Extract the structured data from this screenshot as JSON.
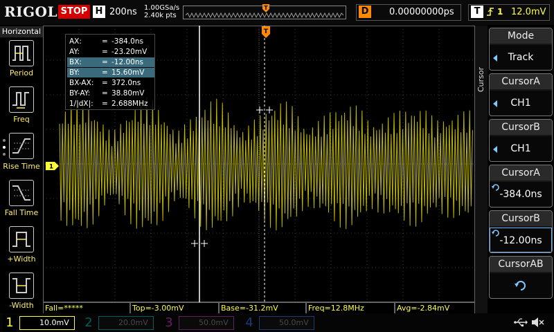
{
  "top_bar": {
    "logo": "RIGOL",
    "run_status": "STOP",
    "timebase_label": "H",
    "timebase": "200ns",
    "sample_rate": "1.00GSa/s",
    "memory_depth": "2.40k pts",
    "delay_label": "D",
    "delay": "0.00000000ps",
    "trigger_label": "T",
    "trigger_source": "1",
    "trigger_level": "12.0mV"
  },
  "left_menu": {
    "title": "Horizontal",
    "items": [
      {
        "label": "Period"
      },
      {
        "label": "Freq"
      },
      {
        "label": "Rise Time"
      },
      {
        "label": "Fall Time"
      },
      {
        "label": "+Width"
      },
      {
        "label": "-Width"
      }
    ]
  },
  "cursor_readout": {
    "rows": [
      {
        "key": "AX:",
        "value": "-384.0ns",
        "highlight": false
      },
      {
        "key": "AY:",
        "value": "-23.20mV",
        "highlight": false
      },
      {
        "key": "BX:",
        "value": "-12.00ns",
        "highlight": true
      },
      {
        "key": "BY:",
        "value": "15.60mV",
        "highlight": true
      },
      {
        "key": "BX-AX:",
        "value": "372.0ns",
        "highlight": false
      },
      {
        "key": "BY-AY:",
        "value": "38.80mV",
        "highlight": false
      },
      {
        "key": "1/|dX|:",
        "value": "2.688MHz",
        "highlight": false
      }
    ],
    "eq": "="
  },
  "markers": {
    "ch1_ground": "1",
    "trigger_time": "T"
  },
  "measurements": [
    {
      "text": "Fall=*****"
    },
    {
      "text": "Top=-3.00mV"
    },
    {
      "text": "Base=-31.2mV"
    },
    {
      "text": "Freq=12.8MHz"
    },
    {
      "text": "Avg=-2.84mV"
    }
  ],
  "right_menu": {
    "title": "Cursor",
    "buttons": [
      {
        "title": "Mode",
        "value": "Track",
        "control": "arrow"
      },
      {
        "title": "CursorA",
        "value": "CH1",
        "control": "arrow"
      },
      {
        "title": "CursorB",
        "value": "CH1",
        "control": "arrow"
      },
      {
        "title": "CursorA",
        "value": "-384.0ns",
        "control": "knob"
      },
      {
        "title": "CursorB",
        "value": "-12.00ns",
        "control": "knob"
      },
      {
        "title": "CursorAB",
        "value": "",
        "control": "knob"
      }
    ]
  },
  "channels": [
    {
      "num": "1",
      "scale": "10.0mV",
      "color": "#ffff3c",
      "active": true
    },
    {
      "num": "2",
      "scale": "20.0mV",
      "color": "#00c8c8",
      "active": false
    },
    {
      "num": "3",
      "scale": "50.0mV",
      "color": "#d040d0",
      "active": false
    },
    {
      "num": "4",
      "scale": "50.0mV",
      "color": "#3c78ff",
      "active": false
    }
  ],
  "colors": {
    "ch1": "#ffff3c",
    "trigger": "#ff8a00",
    "stop": "#d40000",
    "highlight": "#3a6b7c"
  },
  "icons": {
    "usb": "usb-icon",
    "speaker": "speaker-muted-icon"
  }
}
